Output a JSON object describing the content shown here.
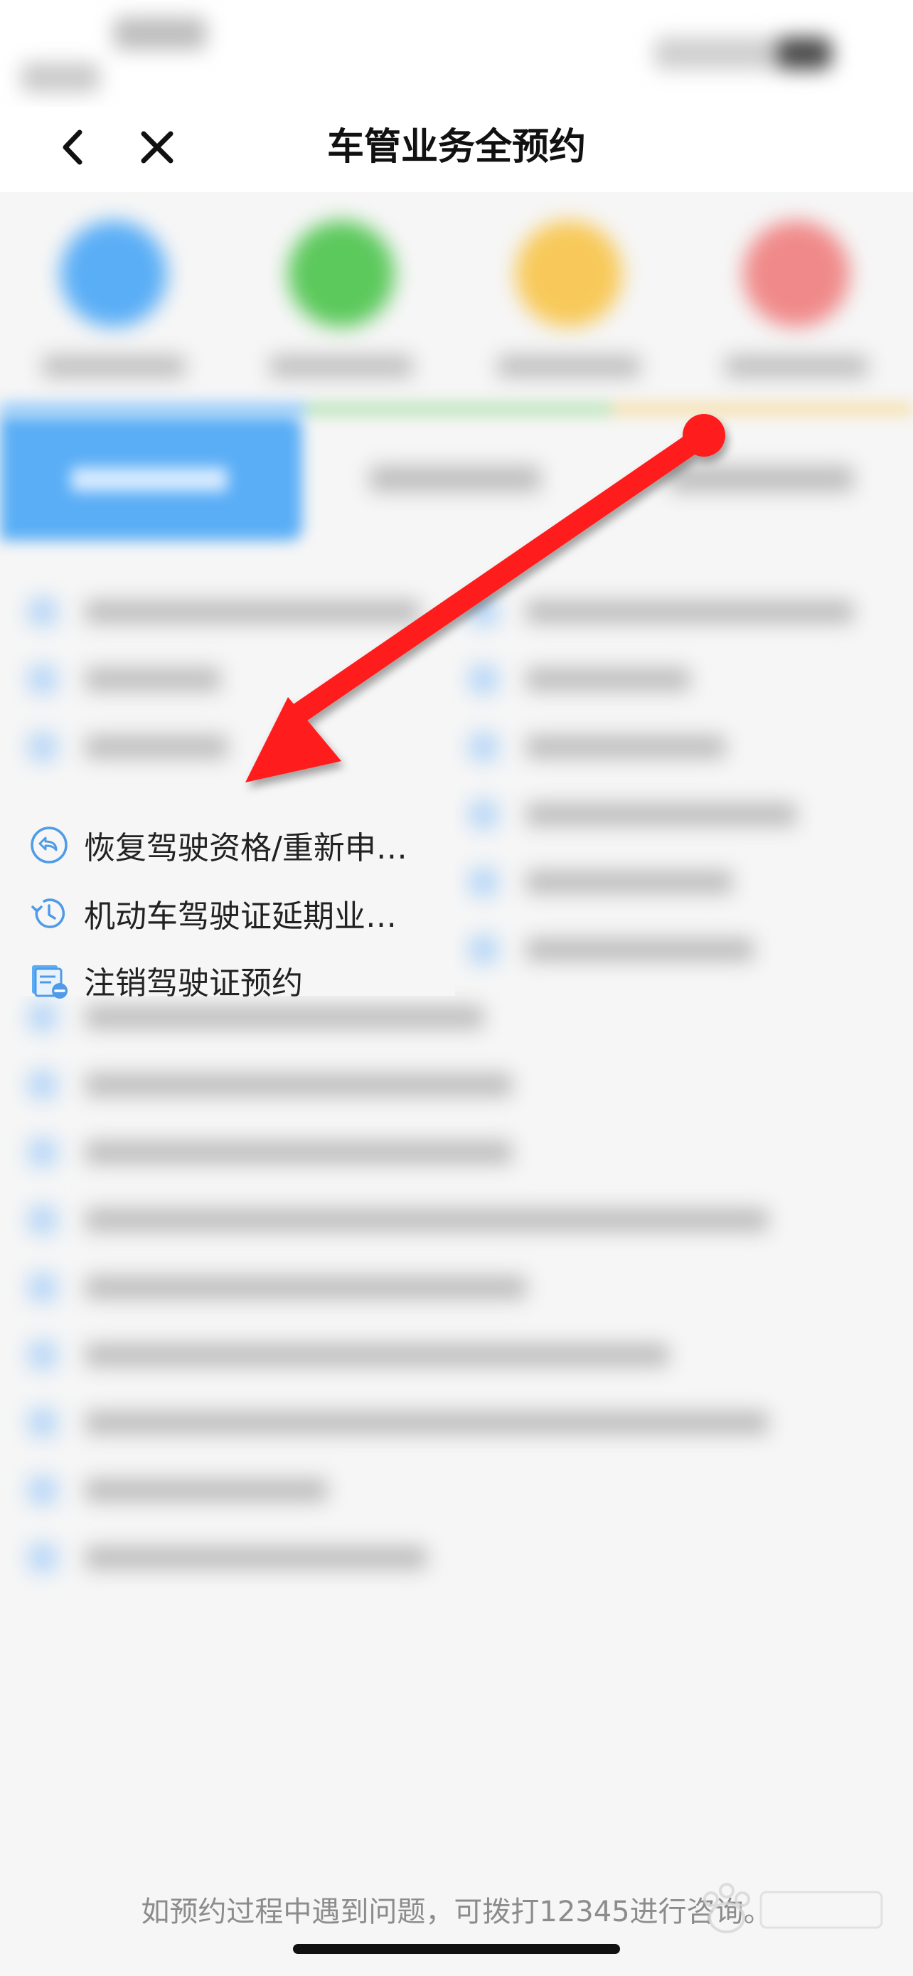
{
  "nav": {
    "title": "车管业务全预约"
  },
  "menu": {
    "items": [
      {
        "label": "恢复驾驶资格/重新申…",
        "icon": "restore-icon"
      },
      {
        "label": "机动车驾驶证延期业…",
        "icon": "clock-refresh-icon"
      },
      {
        "label": "注销驾驶证预约",
        "icon": "document-remove-icon"
      }
    ]
  },
  "footer": {
    "text": "如预约过程中遇到问题，可拨打12345进行咨询。"
  },
  "colors": {
    "accent_blue": "#5aaef6",
    "category_green": "#5cc95c",
    "category_yellow": "#f8c95a",
    "category_red": "#f08a8a",
    "arrow_red": "#ff1a1a"
  }
}
